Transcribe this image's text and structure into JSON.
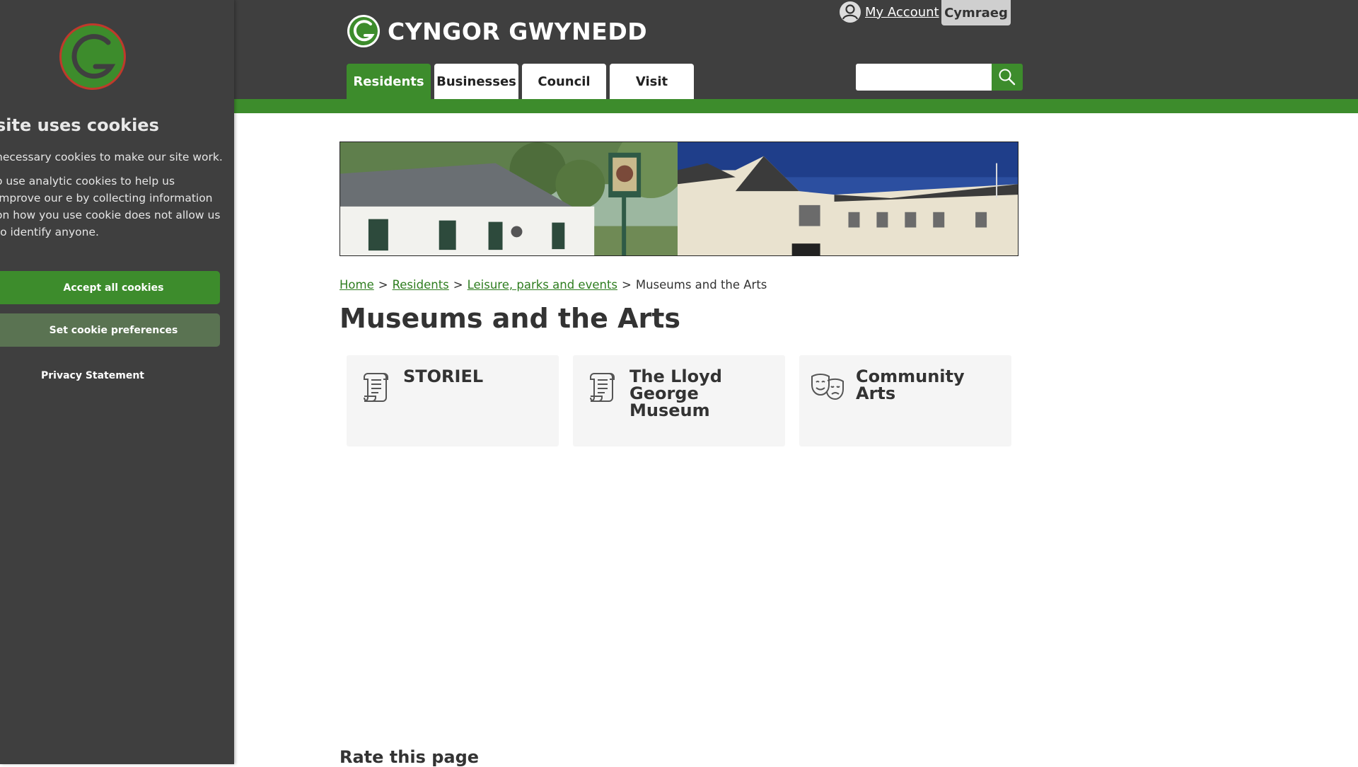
{
  "header": {
    "site_name": "CYNGOR GWYNEDD",
    "account_label": "My Account",
    "language_label": "Cymraeg",
    "search": {
      "placeholder": "",
      "value": ""
    },
    "nav_tabs": [
      {
        "label": "Residents",
        "active": true
      },
      {
        "label": "Businesses",
        "active": false
      },
      {
        "label": "Council",
        "active": false
      },
      {
        "label": "Visit",
        "active": false
      }
    ]
  },
  "cookie_panel": {
    "title": "site uses cookies",
    "text_necessary": "necessary cookies to make our site work.",
    "text_analytics": "o use analytic cookies to help us improve our e by collecting information on how you use cookie does not allow us to identify anyone.",
    "accept_label": "Accept all cookies",
    "preferences_label": "Set cookie preferences",
    "privacy_label": "Privacy Statement"
  },
  "breadcrumb": {
    "items": [
      "Home",
      "Residents",
      "Leisure, parks and events"
    ],
    "separator": ">",
    "current": "Museums and the Arts"
  },
  "page_title": "Museums and the Arts",
  "cards": [
    {
      "title": "STORIEL",
      "icon": "scroll-icon"
    },
    {
      "title": "The Lloyd George Museum",
      "icon": "scroll-icon"
    },
    {
      "title": "Community Arts",
      "icon": "theatre-masks-icon"
    }
  ],
  "rate_heading": "Rate this page",
  "colors": {
    "brand_green": "#3d8c2c",
    "header_dark": "#3f3f3f",
    "card_bg": "#f5f5f5",
    "link_green": "#2e7d1f"
  }
}
